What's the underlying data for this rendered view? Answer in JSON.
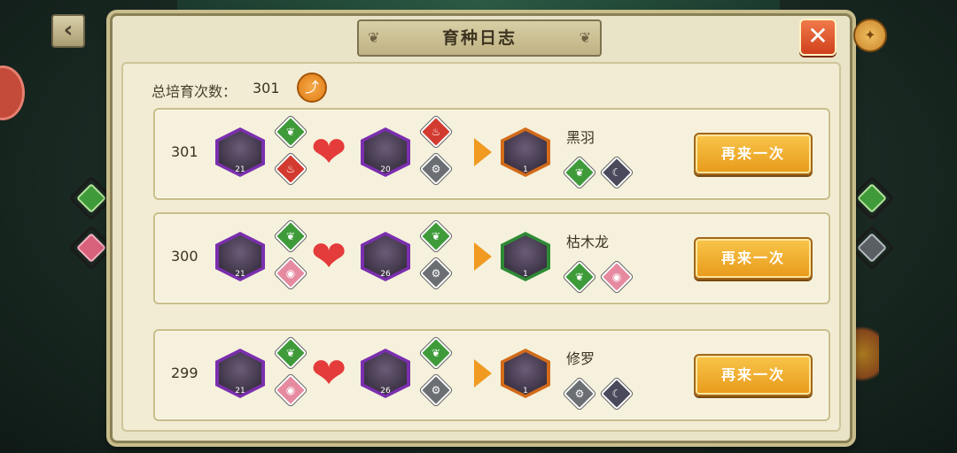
{
  "title": "育种日志",
  "total": {
    "label": "总培育次数：",
    "value": "301"
  },
  "rows": [
    {
      "num": "301",
      "parent1": {
        "level": "21",
        "elems": [
          "leaf-icon",
          "fire-icon"
        ]
      },
      "parent2": {
        "level": "20",
        "elems": [
          "fire-icon",
          "bolt-icon"
        ]
      },
      "result": {
        "level": "1",
        "name": "黑羽",
        "elems": [
          "leaf-icon",
          "moon-icon"
        ]
      },
      "again": "再来一次"
    },
    {
      "num": "300",
      "parent1": {
        "level": "21",
        "elems": [
          "leaf-icon",
          "eye-icon"
        ]
      },
      "parent2": {
        "level": "26",
        "elems": [
          "leaf-icon",
          "bolt-icon"
        ]
      },
      "result": {
        "level": "1",
        "name": "枯木龙",
        "elems": [
          "leaf-icon",
          "eye-icon"
        ]
      },
      "again": "再来一次"
    },
    {
      "num": "299",
      "parent1": {
        "level": "21",
        "elems": [
          "leaf-icon",
          "eye-icon"
        ]
      },
      "parent2": {
        "level": "26",
        "elems": [
          "leaf-icon",
          "bolt-icon"
        ]
      },
      "result": {
        "level": "1",
        "name": "修罗",
        "elems": [
          "bolt-icon",
          "moon-icon"
        ]
      },
      "again": "再来一次"
    }
  ],
  "colors": {
    "accent": "#f09a22",
    "panel": "#e9e4c8",
    "heart": "#e43b3b"
  }
}
